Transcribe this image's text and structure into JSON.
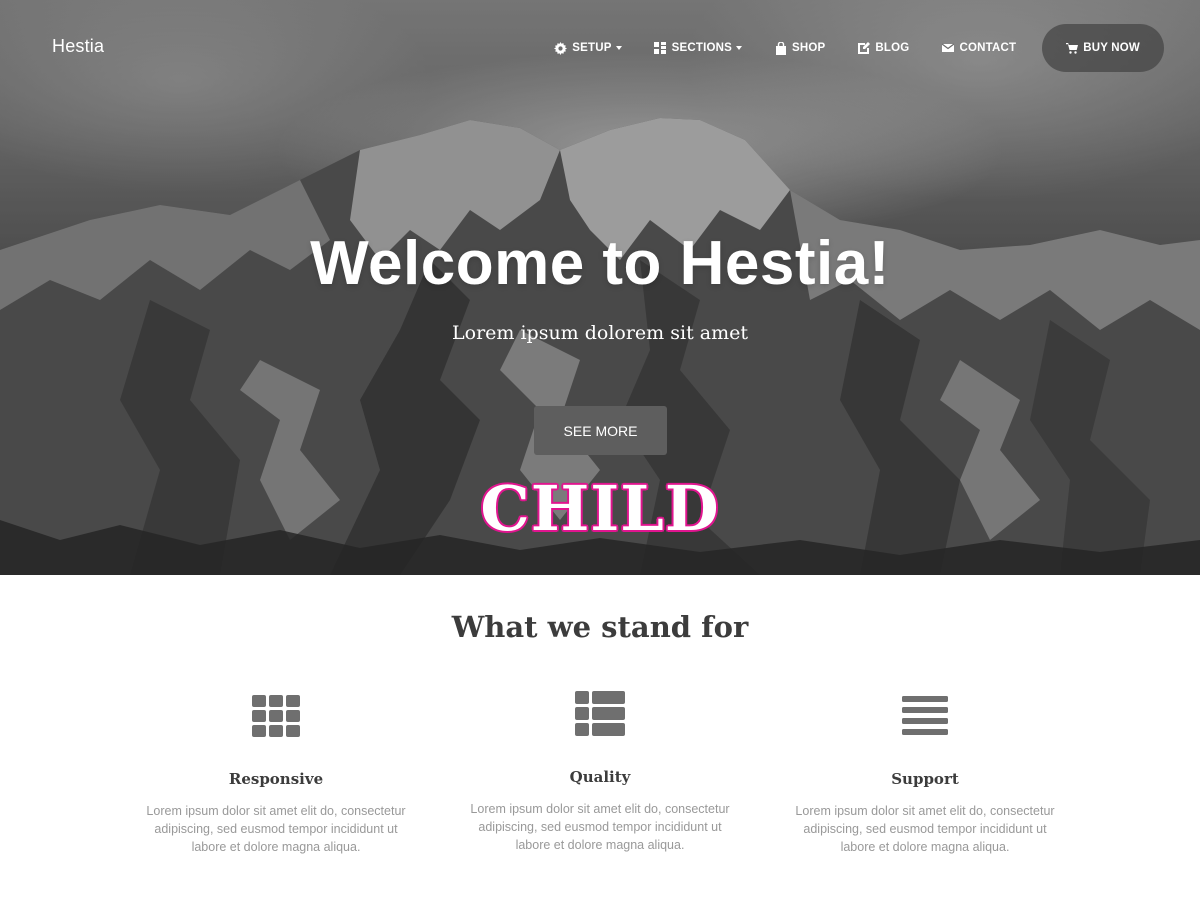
{
  "nav": {
    "brand": "Hestia",
    "items": [
      {
        "label": "SETUP",
        "icon": "gear-icon",
        "dropdown": true
      },
      {
        "label": "SECTIONS",
        "icon": "grid-icon",
        "dropdown": true
      },
      {
        "label": "SHOP",
        "icon": "bag-icon",
        "dropdown": false
      },
      {
        "label": "BLOG",
        "icon": "edit-icon",
        "dropdown": false
      },
      {
        "label": "CONTACT",
        "icon": "envelope-icon",
        "dropdown": false
      }
    ],
    "buy_label": "BUY NOW",
    "buy_icon": "cart-icon"
  },
  "hero": {
    "title": "Welcome to Hestia!",
    "subtitle": "Lorem ipsum dolorem sit amet",
    "button_label": "SEE MORE",
    "logo_text": "CHILD"
  },
  "features": {
    "title": "What we stand for",
    "items": [
      {
        "title": "Responsive",
        "icon": "grid-icon",
        "text": "Lorem ipsum dolor sit amet elit do, consectetur adipiscing, sed eusmod tempor incididunt ut labore et dolore magna aliqua."
      },
      {
        "title": "Quality",
        "icon": "list-alt-icon",
        "text": "Lorem ipsum dolor sit amet elit do, consectetur adipiscing, sed eusmod tempor incididunt ut labore et dolore magna aliqua."
      },
      {
        "title": "Support",
        "icon": "menu-icon",
        "text": "Lorem ipsum dolor sit amet elit do, consectetur adipiscing, sed eusmod tempor incididunt ut labore et dolore magna aliqua."
      }
    ]
  },
  "colors": {
    "logo_outline": "#e0158f",
    "button_bg": "#5e5e5e",
    "feature_icon": "#6f6f6f"
  }
}
